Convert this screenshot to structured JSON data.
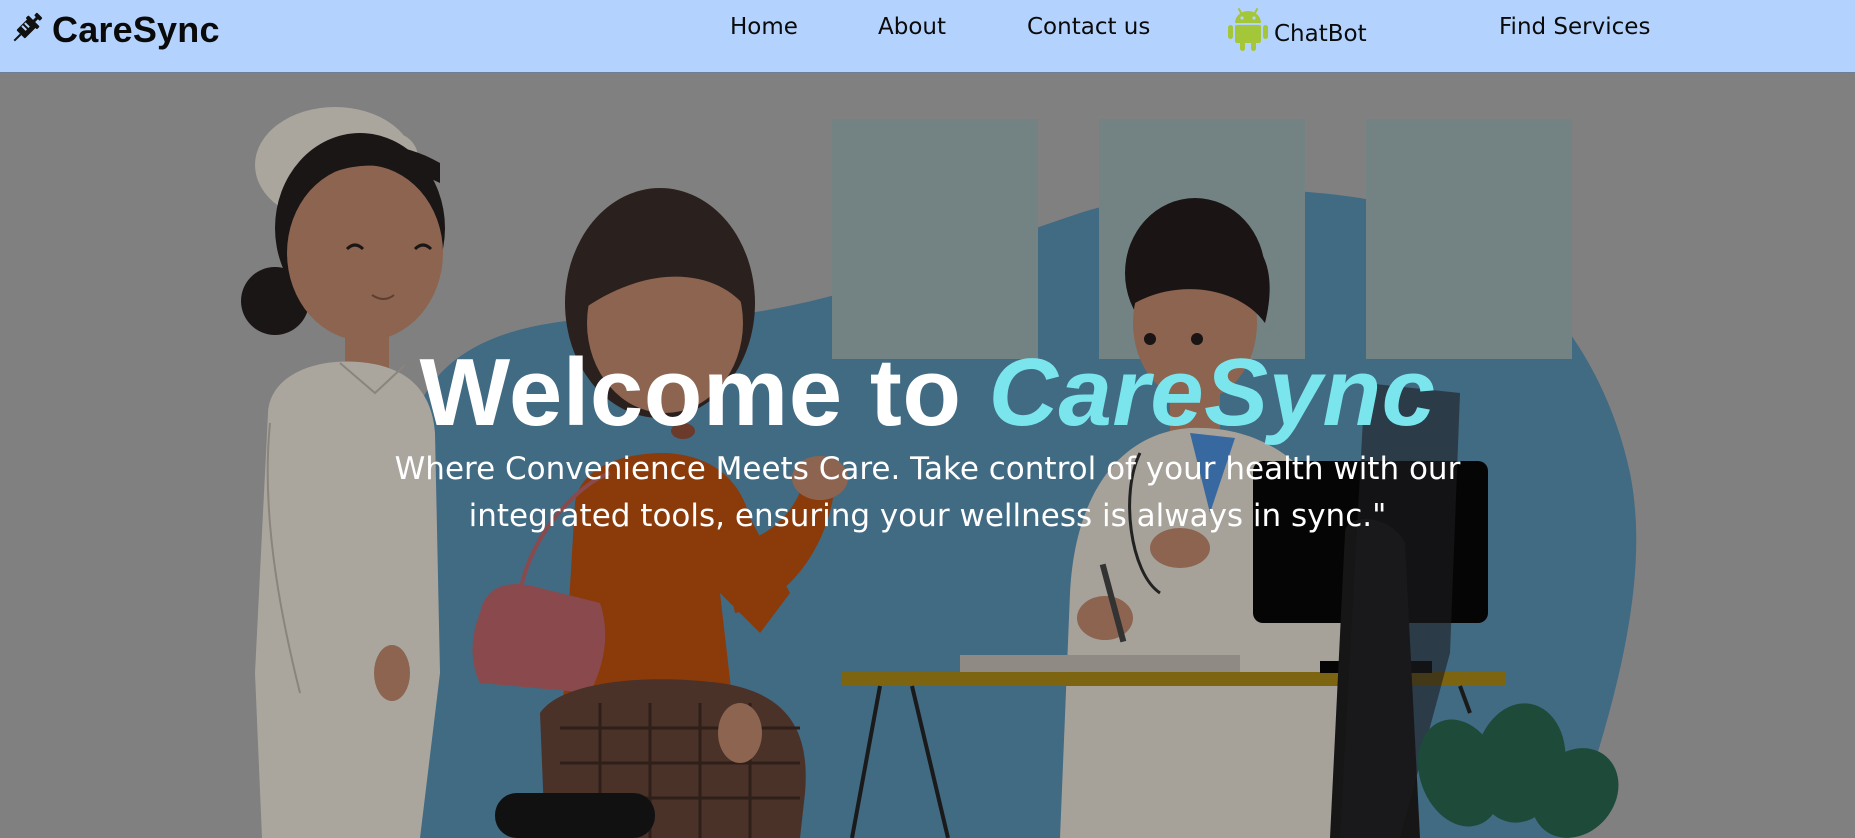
{
  "brand": {
    "name": "CareSync",
    "icon": "syringe-icon"
  },
  "nav": {
    "home": "Home",
    "about": "About",
    "contact": "Contact us",
    "chatbot": "ChatBot",
    "chatbot_icon": "android-icon",
    "services": "Find Services"
  },
  "hero": {
    "title_prefix": "Welcome to",
    "title_accent": "CareSync",
    "subtitle": "Where Convenience Meets Care. Take control of your health with our integrated tools, ensuring your wellness is always in sync.\""
  },
  "colors": {
    "navbar_bg": "#b3d3fe",
    "hero_overlay": "#808080",
    "accent": "#7be5ee",
    "android_green": "#a4c639"
  }
}
